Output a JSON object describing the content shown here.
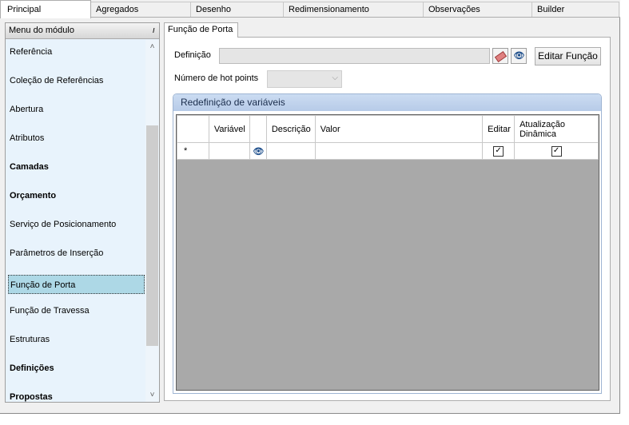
{
  "top_tabs": [
    "Principal",
    "Agregados",
    "Desenho",
    "Redimensionamento",
    "Observações",
    "Builder"
  ],
  "left_panel": {
    "header": "Menu do módulo",
    "items": [
      {
        "label": "Referência",
        "bold": false
      },
      {
        "label": "Coleção de Referências",
        "bold": false
      },
      {
        "label": "Abertura",
        "bold": false
      },
      {
        "label": "Atributos",
        "bold": false
      },
      {
        "label": "Camadas",
        "bold": true
      },
      {
        "label": "Orçamento",
        "bold": true
      },
      {
        "label": "Serviço de Posicionamento",
        "bold": false
      },
      {
        "label": "Parâmetros de Inserção",
        "bold": false
      },
      {
        "label": "Função de Porta",
        "bold": false,
        "selected": true
      },
      {
        "label": "Função de Travessa",
        "bold": false
      },
      {
        "label": "Estruturas",
        "bold": false
      },
      {
        "label": "Definições",
        "bold": true
      },
      {
        "label": "Propostas",
        "bold": true
      }
    ]
  },
  "content": {
    "tab": "Função de Porta",
    "definicao_label": "Definição",
    "definicao_value": "",
    "editar_funcao_button": "Editar Função",
    "hotpoints_label": "Número de hot points",
    "hotpoints_value": "",
    "group_title": "Redefinição de variáveis",
    "grid": {
      "columns": [
        "Variável",
        "",
        "Descrição",
        "Valor",
        "Editar",
        "Atualização Dinâmica"
      ],
      "new_row_marker": "*",
      "new_row": {
        "editar_checked": true,
        "atualizacao_checked": true
      }
    }
  },
  "icons": {
    "pin": "pin-icon",
    "eraser": "eraser-icon",
    "binoculars": "binoculars-icon",
    "check": "checkmark-icon"
  },
  "colors": {
    "left_panel_bg": "#e8f3fc",
    "selected_item_bg": "#add8e6",
    "group_header": "#c4d6ef",
    "grid_empty_bg": "#a9a9a9"
  }
}
